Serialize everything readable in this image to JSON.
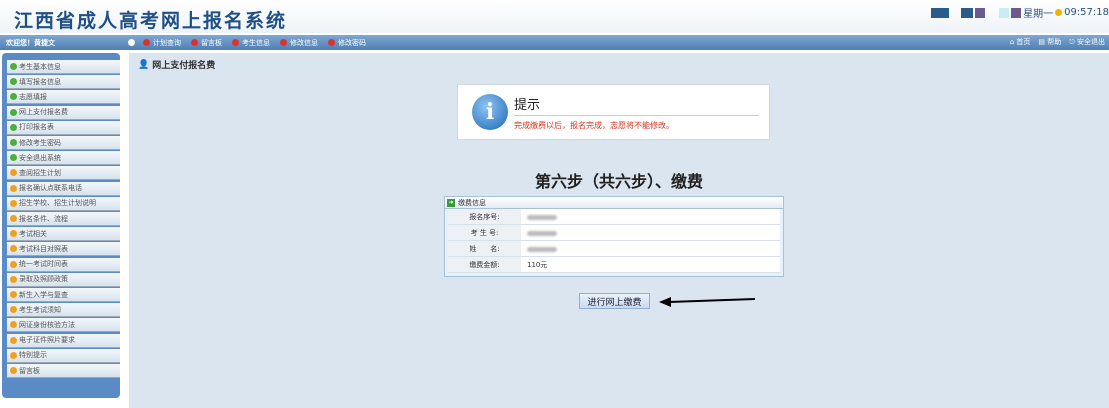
{
  "header": {
    "title": "江西省成人高考网上报名系统",
    "weekday": "星期一",
    "time": "09:57:18",
    "colors": {
      "nav": "#4f7fb3",
      "notice_red": "#e0301e"
    }
  },
  "nav": {
    "welcome": "欢迎您！黄捷文",
    "items": [
      "计划查询",
      "留言板",
      "考生信息",
      "修改信息",
      "修改密码"
    ],
    "right": [
      "首页",
      "帮助",
      "安全退出"
    ]
  },
  "sidebar": {
    "items": [
      {
        "label": "考生基本信息",
        "icon": "green"
      },
      {
        "label": "填写报名信息",
        "icon": "green"
      },
      {
        "label": "志愿填报",
        "icon": "green"
      },
      {
        "label": "网上支付报名费",
        "icon": "green"
      },
      {
        "label": "打印报名表",
        "icon": "green"
      },
      {
        "label": "修改考生密码",
        "icon": "green"
      },
      {
        "label": "安全退出系统",
        "icon": "green"
      },
      {
        "label": "查阅招生计划",
        "icon": "orange"
      },
      {
        "label": "报名确认点联系电话",
        "icon": "orange"
      },
      {
        "label": "招生学校、招生计划说明",
        "icon": "orange"
      },
      {
        "label": "报名条件、流程",
        "icon": "orange"
      },
      {
        "label": "考试相关",
        "icon": "orange"
      },
      {
        "label": "考试科目对照表",
        "icon": "orange"
      },
      {
        "label": "统一考试时间表",
        "icon": "orange"
      },
      {
        "label": "录取及照顾政策",
        "icon": "orange"
      },
      {
        "label": "新生入学与复查",
        "icon": "orange"
      },
      {
        "label": "考生考试须知",
        "icon": "orange"
      },
      {
        "label": "网证身份核验方法",
        "icon": "orange"
      },
      {
        "label": "电子证件照片要求",
        "icon": "orange"
      },
      {
        "label": "特别提示",
        "icon": "orange"
      },
      {
        "label": "留言板",
        "icon": "orange"
      }
    ]
  },
  "main": {
    "page_title": "网上支付报名费",
    "notice": {
      "title": "提示",
      "message": "完成缴费以后，报名完成，志愿将不能修改。"
    },
    "step": "第六步（共六步）、缴费",
    "table": {
      "header": "缴费信息",
      "rows": [
        {
          "label": "报名序号:",
          "value": ""
        },
        {
          "label": "考 生 号:",
          "value": ""
        },
        {
          "label": "姓　　名:",
          "value": ""
        },
        {
          "label": "缴费金额:",
          "value": "110元"
        }
      ]
    },
    "pay_button": "进行网上缴费"
  }
}
